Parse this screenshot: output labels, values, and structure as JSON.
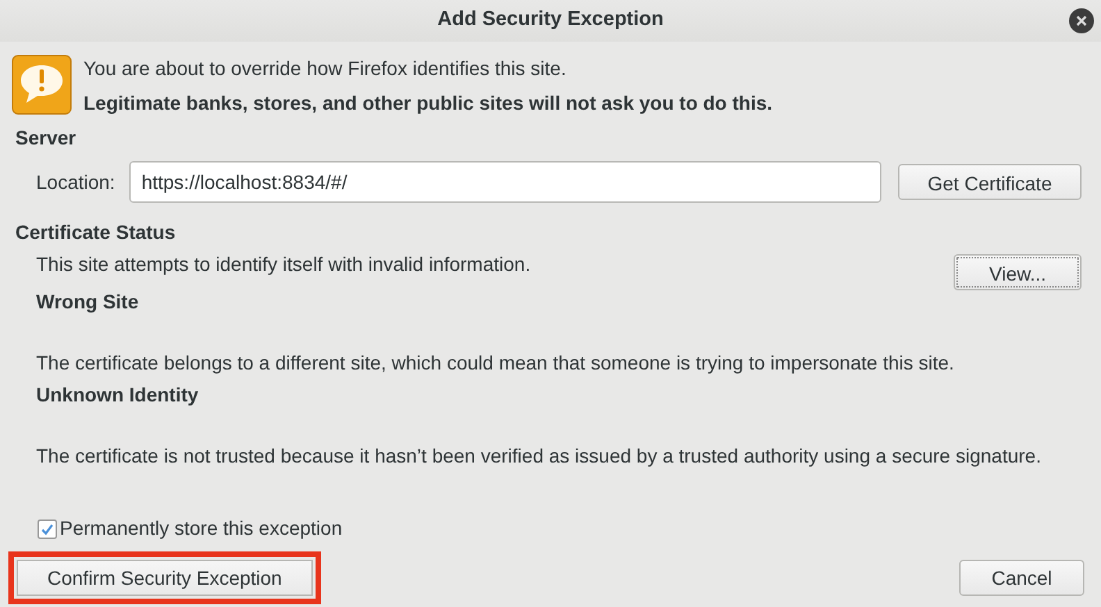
{
  "window": {
    "title": "Add Security Exception"
  },
  "warning": {
    "line_1": "You are about to override how Firefox identifies this site.",
    "line_2": "Legitimate banks, stores, and other public sites will not ask you to do this."
  },
  "server": {
    "heading": "Server",
    "location_label": "Location:",
    "location_value": "https://localhost:8834/#/",
    "get_certificate_button": "Get Certificate"
  },
  "certificate_status": {
    "heading": "Certificate Status",
    "summary": "This site attempts to identify itself with invalid information.",
    "view_button": "View...",
    "problems": [
      {
        "title": "Wrong Site",
        "description": "The certificate belongs to a different site, which could mean that someone is trying to impersonate this site."
      },
      {
        "title": "Unknown Identity",
        "description": "The certificate is not trusted because it hasn’t been verified as issued by a trusted authority using a secure signature."
      }
    ]
  },
  "permanent_checkbox": {
    "label": "Permanently store this exception",
    "checked": true
  },
  "buttons": [
    {
      "label": "Confirm Security Exception",
      "highlighted": true
    },
    {
      "label": "Cancel",
      "highlighted": false
    }
  ]
}
